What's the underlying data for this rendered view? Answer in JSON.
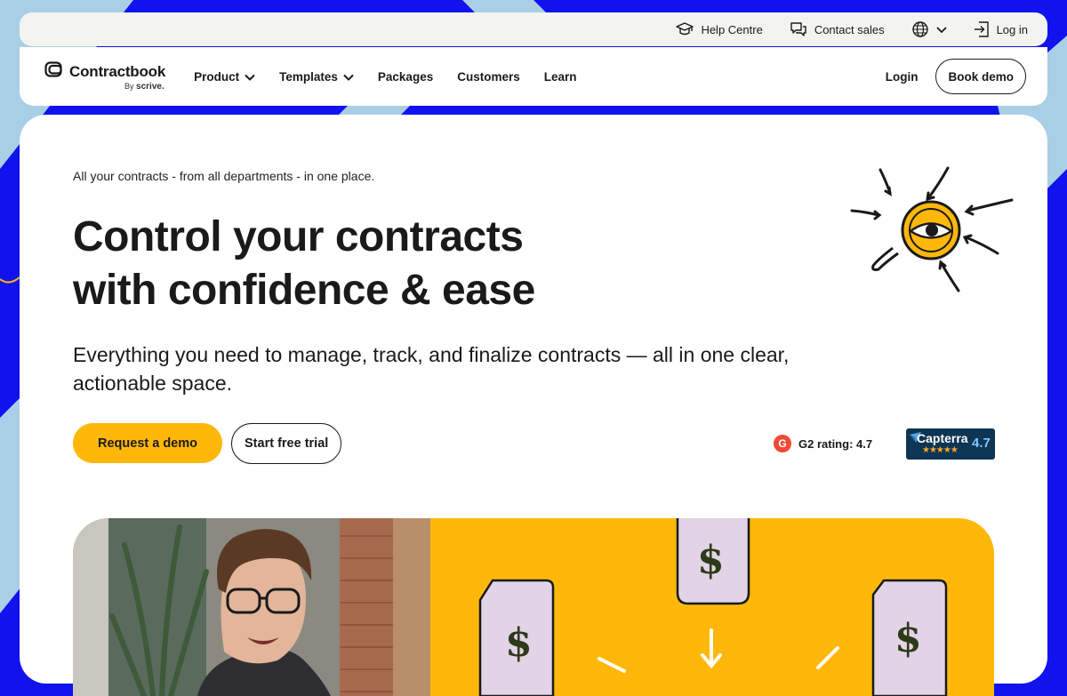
{
  "utility": {
    "help": "Help Centre",
    "contact": "Contact sales",
    "login": "Log in",
    "icons": [
      "graduation-cap-icon",
      "chat-bubbles-icon",
      "globe-icon",
      "chevron-down-icon",
      "sign-in-icon"
    ]
  },
  "nav": {
    "logo": "Contractbook",
    "logo_by": "By",
    "logo_brand": "scrive.",
    "items": [
      {
        "label": "Product",
        "has_dropdown": true
      },
      {
        "label": "Templates",
        "has_dropdown": true
      },
      {
        "label": "Packages",
        "has_dropdown": false
      },
      {
        "label": "Customers",
        "has_dropdown": false
      },
      {
        "label": "Learn",
        "has_dropdown": false
      }
    ],
    "login": "Login",
    "cta": "Book demo"
  },
  "hero": {
    "eyebrow": "All your contracts - from all departments - in one place.",
    "headline_line1": "Control your contracts",
    "headline_line2": "with confidence & ease",
    "subhead": "Everything you need to manage, track, and finalize contracts — all in one clear, actionable space.",
    "cta_primary": "Request a demo",
    "cta_secondary": "Start free trial",
    "g2_badge": "G",
    "g2": "G2 rating: 4.7",
    "capterra_name": "Capterra",
    "capterra_stars": "★★★★★",
    "capterra_score": "4.7"
  },
  "media": {
    "illustration_symbol": "$"
  },
  "colors": {
    "page_bg": "#1212ee",
    "stripe": "#a9cfe6",
    "accent_yellow": "#ffb80a",
    "card_bg": "#ffffff",
    "util_bg": "#f3f4f0",
    "dollar_card": "#e3d3e6",
    "capterra_bg": "#0e3553",
    "g2_red": "#ef4a36"
  }
}
